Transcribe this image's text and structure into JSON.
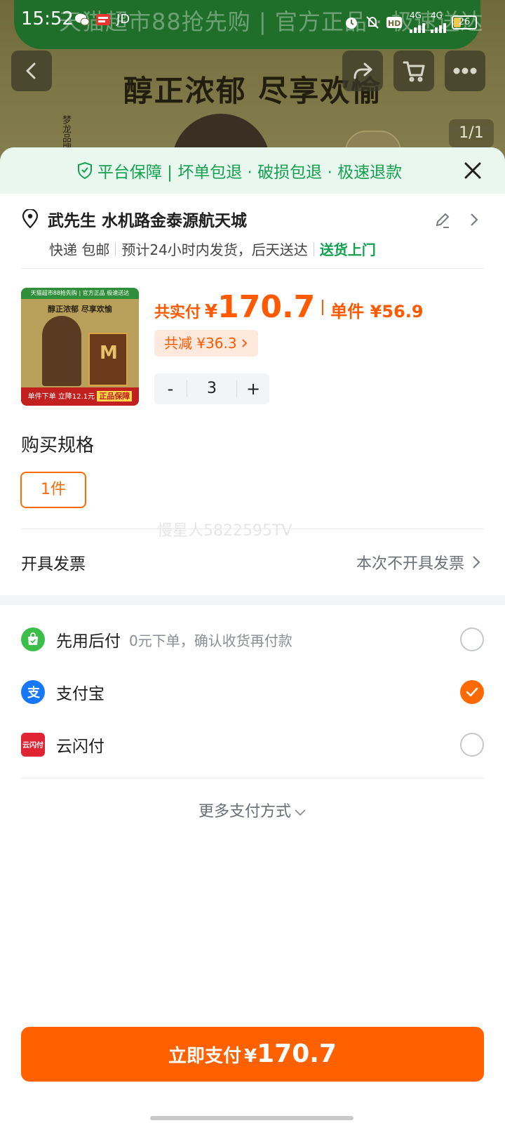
{
  "status_bar": {
    "time": "15:52",
    "app_label": "JD",
    "network": "4G",
    "battery": "26"
  },
  "background_page": {
    "banner_text": "天猫超市88抢先购 | 官方正品 · 极速送达",
    "headline": "醇正浓郁 尽享欢愉",
    "side_text": "梦龙品牌",
    "image_counter": "1/1"
  },
  "guarantee": {
    "text": "平台保障 | 坏单包退 · 破损包退 · 极速退款"
  },
  "address": {
    "name_and_address": "武先生 水机路金泰源航天城",
    "delivery_method": "快递 包邮",
    "shipping_time": "预计24小时内发货，后天送达",
    "door_delivery": "送货上门"
  },
  "product": {
    "thumb_top": "天猫超市88抢先购 | 官方正品 极速送达",
    "thumb_headline": "醇正浓郁 尽享欢愉",
    "thumb_box": "M",
    "thumb_bottom_1": "单件下单 立降12.1元",
    "thumb_bottom_2": "正品保障",
    "total_label": "共实付",
    "currency": "¥",
    "total_price": "170.7",
    "unit_price": "单件 ¥56.9",
    "discount": "共减 ¥36.3",
    "quantity": "3",
    "minus": "-",
    "plus": "+"
  },
  "spec": {
    "title": "购买规格",
    "option": "1件",
    "watermark": "慢星人5822595TV"
  },
  "invoice": {
    "label": "开具发票",
    "value": "本次不开具发票"
  },
  "payment_methods": [
    {
      "name": "先用后付",
      "desc": "0元下单，确认收货再付款",
      "selected": false,
      "icon": "bag-check-icon",
      "color": "#3bbf4a"
    },
    {
      "name": "支付宝",
      "desc": "",
      "selected": true,
      "icon": "alipay-icon",
      "color": "#1677ff"
    },
    {
      "name": "云闪付",
      "desc": "",
      "selected": false,
      "icon": "unionpay-icon",
      "color": "#e02433"
    }
  ],
  "more_payment": "更多支付方式",
  "pay_button": {
    "label": "立即支付",
    "currency": "¥",
    "amount": "170.7"
  },
  "colors": {
    "accent": "#ff6000",
    "green": "#12a150",
    "guarantee_bg": "#e9f7ee"
  }
}
